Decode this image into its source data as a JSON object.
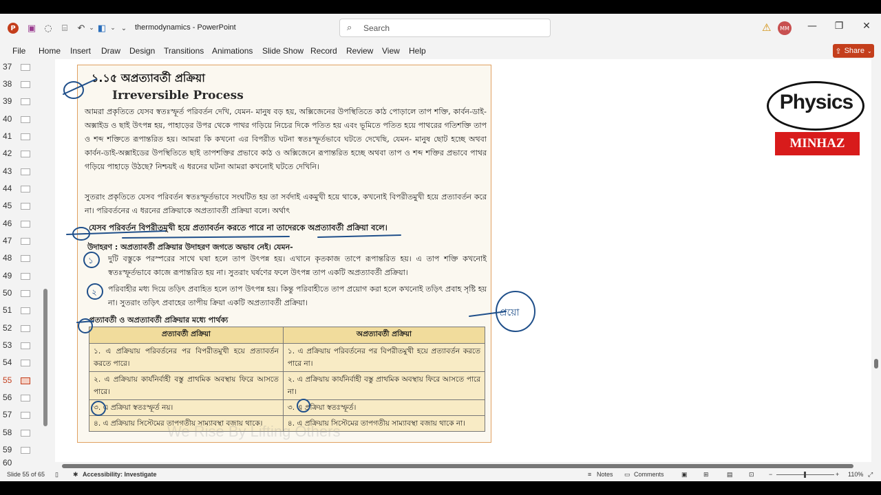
{
  "titlebar": {
    "app_logo": "P",
    "document_title": "thermodynamics",
    "app_name": "PowerPoint",
    "title_sep": " - ",
    "search_placeholder": "Search",
    "user_initials": "MM"
  },
  "ribbon": {
    "tabs": [
      "File",
      "Home",
      "Insert",
      "Draw",
      "Design",
      "Transitions",
      "Animations",
      "Slide Show",
      "Record",
      "Review",
      "View",
      "Help"
    ],
    "share_label": "Share"
  },
  "thumbnails": {
    "numbers": [
      "37",
      "38",
      "39",
      "40",
      "41",
      "42",
      "43",
      "44",
      "45",
      "46",
      "47",
      "48",
      "49",
      "50",
      "51",
      "52",
      "53",
      "54",
      "55",
      "56",
      "57",
      "58",
      "59",
      "60"
    ],
    "active": "55"
  },
  "slide": {
    "heading_bn": "১.১৫ অপ্রত্যাবর্তী প্রক্রিয়া",
    "heading_en": "Irreversible Process",
    "para1": "আমরা প্রকৃতিতে যেসব স্বতঃস্ফূর্ত পরিবর্তন দেখি, যেমন- মানুষ বড় হয়, অক্সিজেনের উপস্থিতিতে কাঠ পোড়ালে তাপ শক্তি, কার্বন-ডাই-অক্সাইড ও ছাই উৎপন্ন হয়, পাহাড়ের উপর থেকে পাথর গড়িয়ে নিচের দিকে পতিত হয় এবং ভূমিতে পতিত হয়ে পাথরের গতিশক্তি তাপ ও শব্দ শক্তিতে রূপান্তরিত হয়। আমরা কি কখনো এর বিপরীত ঘটনা স্বতঃস্ফূর্তভাবে ঘটতে দেখেছি, যেমন- মানুষ ছোট হচ্ছে অথবা কার্বন-ডাই-অক্সাইডের উপস্থিতিতে ছাই তাপশক্তির প্রভাবে কাঠ ও অক্সিজেনে রূপান্তরিত হচ্ছে অথবা তাপ ও শব্দ শক্তির প্রভাবে পাথর গড়িয়ে পাহাড়ে উঠছে? নিশ্চয়ই এ ধরনের ঘটনা আমরা কখনোই ঘটতে দেখিনি।",
    "para2": "সুতরাং প্রকৃতিতে যেসব পরিবর্তন স্বতঃস্ফূর্তভাবে সংঘটিত হয় তা সর্বদাই একমুখী হয়ে থাকে, কখনোই বিপরীতমুখী হয়ে প্রত্যাবর্তন করে না। পরিবর্তনের এ ধরনের প্রক্রিয়াকে অপ্রত্যাবর্তী প্রক্রিয়া বলে। অর্থাৎ",
    "definition": "যেসব পরিবর্তন বিপরীতমুখী হয়ে প্রত্যাবর্তন করতে পারে না তাদেরকে অপ্রত্যাবর্তী প্রক্রিয়া বলে।",
    "example_label": "উদাহরণ : অপ্রত্যাবর্তী প্রক্রিয়ার উদাহরণ জগতে অভাব নেই। যেমন-",
    "example1": "দুটি বস্তুকে পরস্পরের সাথে ঘষা হলে তাপ উৎপন্ন হয়। এখানে কৃতকাজ তাপে রূপান্তরিত হয়। এ তাপ শক্তি কখনোই স্বতঃস্ফূর্তভাবে কাজে রূপান্তরিত হয় না। সুতরাং ঘর্ষণের ফলে উৎপন্ন তাপ একটি অপ্রত্যাবর্তী প্রক্রিয়া।",
    "example2": "পরিবাহীর মধ্য দিয়ে তড়িৎ প্রবাহিত হলে তাপ উৎপন্ন হয়। কিন্তু পরিবাহীতে তাপ প্রয়োগ করা হলে কখনোই তড়িৎ প্রবাহ সৃষ্টি হয় না। সুতরাং তড়িৎ প্রবাহের তাপীয় ক্রিয়া একটি অপ্রত্যাবর্তী প্রক্রিয়া।",
    "diff_title": "প্রত্যাবর্তী ও অপ্রত্যাবর্তী প্রক্রিয়ার মধ্যে পার্থক্য",
    "table": {
      "headers": [
        "প্রত্যাবর্তী প্রক্রিয়া",
        "অপ্রত্যাবর্তী প্রক্রিয়া"
      ],
      "rows": [
        [
          "১. এ প্রক্রিয়ায় পরিবর্তনের পর বিপরীতমুখী হয়ে প্রত্যাবর্তন করতে পারে।",
          "১. এ প্রক্রিয়ায় পরিবর্তনের পর বিপরীতমুখী হয়ে প্রত্যাবর্তন করতে পারে না।"
        ],
        [
          "২. এ প্রক্রিয়ায় কার্যনির্বাহী বস্তু প্রাথমিক অবস্থায় ফিরে আসতে পারে।",
          "২. এ প্রক্রিয়ায় কার্যনির্বাহী বস্তু প্রাথমিক অবস্থায় ফিরে আসতে পারে না।"
        ],
        [
          "৩. এ প্রক্রিয়া স্বতঃস্ফূর্ত নয়।",
          "৩. এ প্রক্রিয়া স্বতঃস্ফূর্ত।"
        ],
        [
          "৪. এ প্রক্রিয়ায় সিস্টেমের তাপগতীয় সাম্যাবস্থা বজায় থাকে।",
          "৪. এ প্রক্রিয়ায় সিস্টেমের তাপগতীয় সাম্যাবস্থা বজায় থাকে না।"
        ]
      ]
    },
    "watermark": "We Rise By Lifting Others",
    "ink_note": "প্রয়ো",
    "ink_numbers": [
      "১",
      "২"
    ]
  },
  "logo": {
    "main": "Physics",
    "tag": "MINHAZ"
  },
  "status": {
    "slide_info": "Slide 55 of 65",
    "accessibility": "Accessibility: Investigate",
    "notes": "Notes",
    "comments": "Comments",
    "zoom": "110%"
  },
  "colors": {
    "accent": "#c43e1c",
    "ink": "#1f4f8a",
    "logo_red": "#d81b1b"
  }
}
